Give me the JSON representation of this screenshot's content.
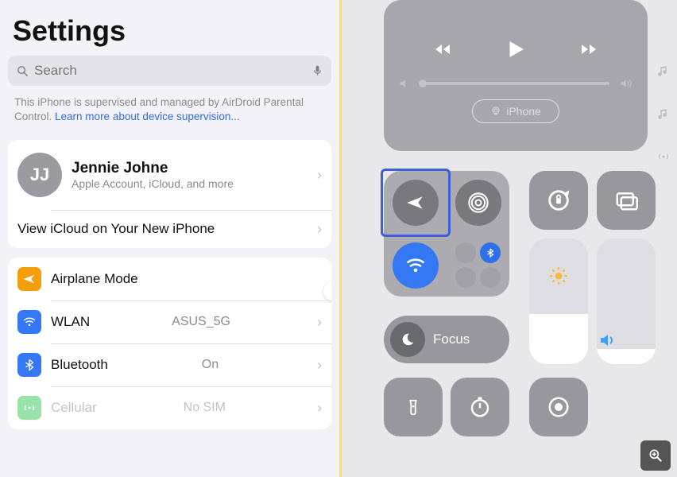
{
  "title": "Settings",
  "search": {
    "placeholder": "Search"
  },
  "supervised": {
    "text": "This iPhone is supervised and managed by AirDroid Parental Control. ",
    "link": "Learn more about device supervision..."
  },
  "profile": {
    "initials": "JJ",
    "name": "Jennie Johne",
    "sub": "Apple Account, iCloud, and more"
  },
  "icloud_promo": "View iCloud on Your New iPhone",
  "items": {
    "airplane": {
      "label": "Airplane Mode"
    },
    "wlan": {
      "label": "WLAN",
      "value": "ASUS_5G"
    },
    "bluetooth": {
      "label": "Bluetooth",
      "value": "On"
    },
    "cellular": {
      "label": "Cellular",
      "value": "No SIM"
    }
  },
  "cc": {
    "airplay": "iPhone",
    "focus": "Focus"
  }
}
